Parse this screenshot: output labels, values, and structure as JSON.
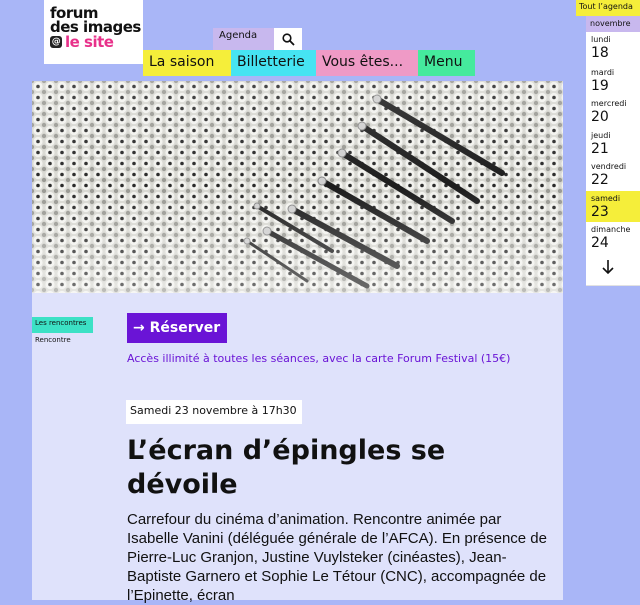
{
  "logo": {
    "line1": "forum",
    "line2": "des images",
    "line3": "le site"
  },
  "header": {
    "agenda_label": "Agenda"
  },
  "nav": {
    "items": [
      "La saison",
      "Billetterie",
      "Vous êtes...",
      "Menu"
    ]
  },
  "categories": [
    "Les rencontres",
    "Rencontre"
  ],
  "reserve": {
    "label": "→ Réserver"
  },
  "access_text": "Accès illimité à toutes les séances, avec la carte Forum Festival (15€)",
  "event": {
    "date": "Samedi 23 novembre à 17h30",
    "title": "L’écran d’épingles se dévoile",
    "description": "Carrefour du cinéma d’animation. Rencontre animée par Isabelle Vanini (déléguée générale de l’AFCA). En présence de Pierre-Luc Granjon, Justine Vuylsteker (cinéastes), Jean-Baptiste Garnero et Sophie Le Tétour (CNC), accompagnée de l’Epinette, écran"
  },
  "agenda_sidebar": {
    "all_label": "Tout l’agenda",
    "month": "novembre",
    "days": [
      {
        "name": "lundi",
        "num": "18"
      },
      {
        "name": "mardi",
        "num": "19"
      },
      {
        "name": "mercredi",
        "num": "20"
      },
      {
        "name": "jeudi",
        "num": "21"
      },
      {
        "name": "vendredi",
        "num": "22"
      },
      {
        "name": "samedi",
        "num": "23"
      },
      {
        "name": "dimanche",
        "num": "24"
      }
    ],
    "selected_day": "23"
  },
  "colors": {
    "background": "#a9b6f7",
    "purple": "#6a14d6",
    "yellow": "#f5ee3a",
    "cyan": "#46e4f2",
    "pink": "#ef9ac6",
    "green": "#45ea9d"
  },
  "icons": [
    "search-icon",
    "arrow-down-icon",
    "arrow-right-icon"
  ]
}
